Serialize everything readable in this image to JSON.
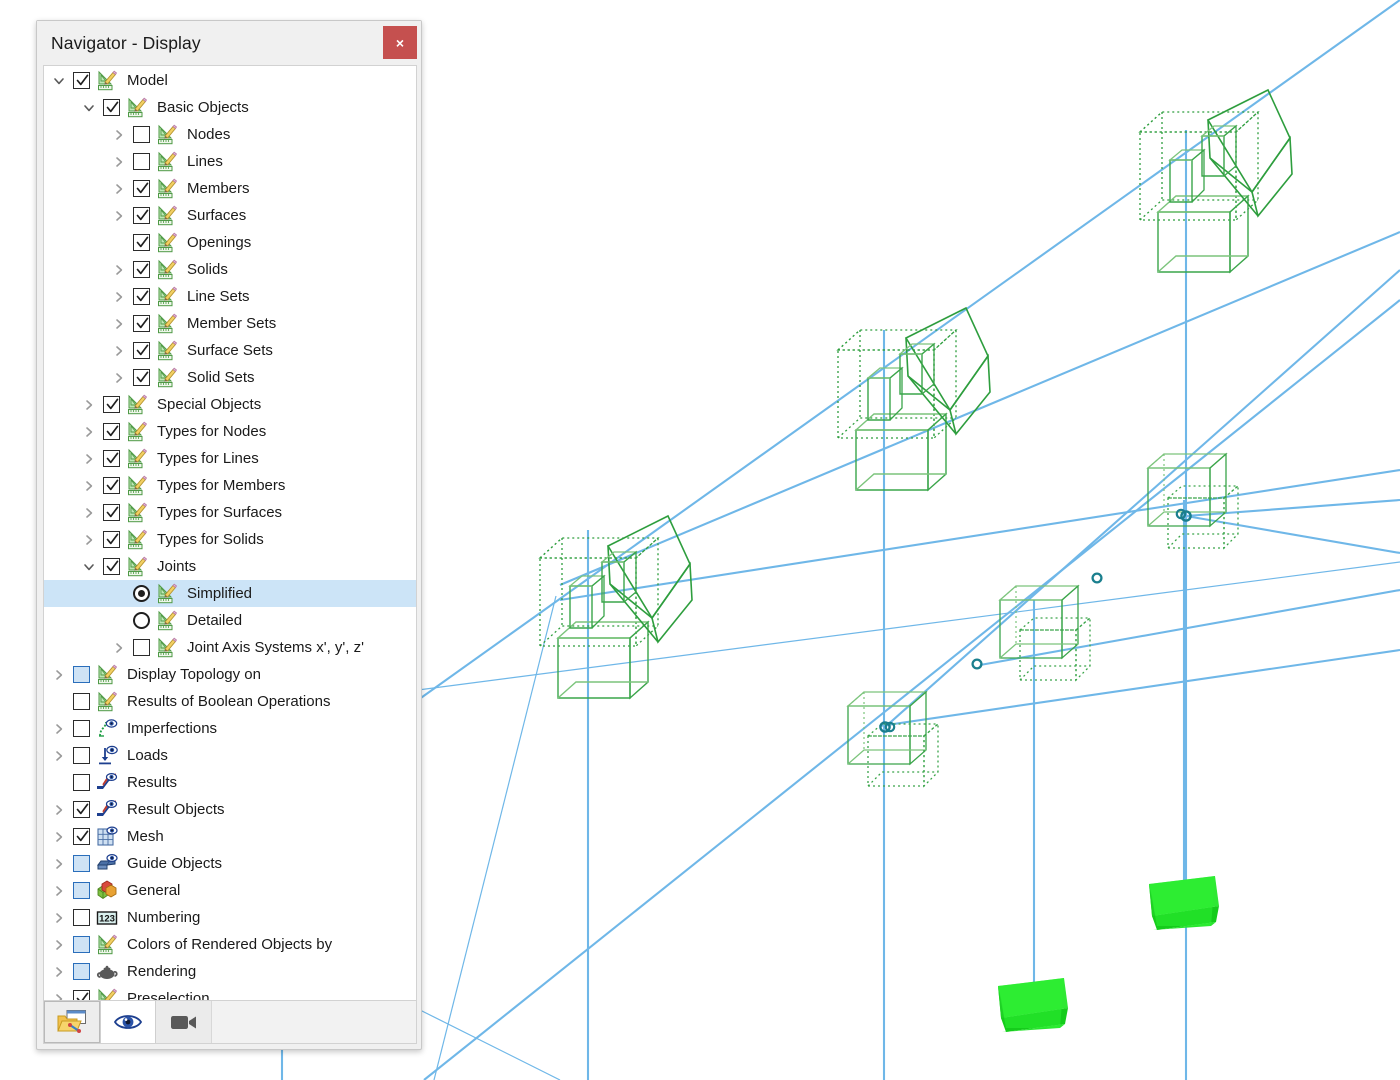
{
  "window": {
    "title": "Navigator - Display",
    "close_label": "×",
    "close_icon": "close-icon"
  },
  "tree": {
    "items": [
      {
        "label": "Model",
        "level": 0,
        "arrow": "down",
        "control": "checkbox",
        "state": "checked",
        "icon": "model-pencil-ruler-icon",
        "selected": false
      },
      {
        "label": "Basic Objects",
        "level": 1,
        "arrow": "down",
        "control": "checkbox",
        "state": "checked",
        "icon": "model-pencil-ruler-icon",
        "selected": false
      },
      {
        "label": "Nodes",
        "level": 2,
        "arrow": "right",
        "control": "checkbox",
        "state": "unchecked",
        "icon": "model-pencil-ruler-icon",
        "selected": false
      },
      {
        "label": "Lines",
        "level": 2,
        "arrow": "right",
        "control": "checkbox",
        "state": "unchecked",
        "icon": "model-pencil-ruler-icon",
        "selected": false
      },
      {
        "label": "Members",
        "level": 2,
        "arrow": "right",
        "control": "checkbox",
        "state": "checked",
        "icon": "model-pencil-ruler-icon",
        "selected": false
      },
      {
        "label": "Surfaces",
        "level": 2,
        "arrow": "right",
        "control": "checkbox",
        "state": "checked",
        "icon": "model-pencil-ruler-icon",
        "selected": false
      },
      {
        "label": "Openings",
        "level": 2,
        "arrow": "none",
        "control": "checkbox",
        "state": "checked",
        "icon": "model-pencil-ruler-icon",
        "selected": false
      },
      {
        "label": "Solids",
        "level": 2,
        "arrow": "right",
        "control": "checkbox",
        "state": "checked",
        "icon": "model-pencil-ruler-icon",
        "selected": false
      },
      {
        "label": "Line Sets",
        "level": 2,
        "arrow": "right",
        "control": "checkbox",
        "state": "checked",
        "icon": "model-pencil-ruler-icon",
        "selected": false
      },
      {
        "label": "Member Sets",
        "level": 2,
        "arrow": "right",
        "control": "checkbox",
        "state": "checked",
        "icon": "model-pencil-ruler-icon",
        "selected": false
      },
      {
        "label": "Surface Sets",
        "level": 2,
        "arrow": "right",
        "control": "checkbox",
        "state": "checked",
        "icon": "model-pencil-ruler-icon",
        "selected": false
      },
      {
        "label": "Solid Sets",
        "level": 2,
        "arrow": "right",
        "control": "checkbox",
        "state": "checked",
        "icon": "model-pencil-ruler-icon",
        "selected": false
      },
      {
        "label": "Special Objects",
        "level": 1,
        "arrow": "right",
        "control": "checkbox",
        "state": "checked",
        "icon": "model-pencil-ruler-icon",
        "selected": false
      },
      {
        "label": "Types for Nodes",
        "level": 1,
        "arrow": "right",
        "control": "checkbox",
        "state": "checked",
        "icon": "model-pencil-ruler-icon",
        "selected": false
      },
      {
        "label": "Types for Lines",
        "level": 1,
        "arrow": "right",
        "control": "checkbox",
        "state": "checked",
        "icon": "model-pencil-ruler-icon",
        "selected": false
      },
      {
        "label": "Types for Members",
        "level": 1,
        "arrow": "right",
        "control": "checkbox",
        "state": "checked",
        "icon": "model-pencil-ruler-icon",
        "selected": false
      },
      {
        "label": "Types for Surfaces",
        "level": 1,
        "arrow": "right",
        "control": "checkbox",
        "state": "checked",
        "icon": "model-pencil-ruler-icon",
        "selected": false
      },
      {
        "label": "Types for Solids",
        "level": 1,
        "arrow": "right",
        "control": "checkbox",
        "state": "checked",
        "icon": "model-pencil-ruler-icon",
        "selected": false
      },
      {
        "label": "Joints",
        "level": 1,
        "arrow": "down",
        "control": "checkbox",
        "state": "checked",
        "icon": "model-pencil-ruler-icon",
        "selected": false
      },
      {
        "label": "Simplified",
        "level": 2,
        "arrow": "none",
        "control": "radio",
        "state": "on",
        "icon": "model-pencil-ruler-icon",
        "selected": true
      },
      {
        "label": "Detailed",
        "level": 2,
        "arrow": "none",
        "control": "radio",
        "state": "off",
        "icon": "model-pencil-ruler-icon",
        "selected": false
      },
      {
        "label": "Joint Axis Systems x', y', z'",
        "level": 2,
        "arrow": "right",
        "control": "checkbox",
        "state": "unchecked",
        "icon": "model-pencil-ruler-icon",
        "selected": false
      },
      {
        "label": "Display Topology on",
        "level": 0,
        "arrow": "right",
        "control": "checkbox",
        "state": "partial",
        "icon": "model-pencil-ruler-icon",
        "selected": false
      },
      {
        "label": "Results of Boolean Operations",
        "level": 0,
        "arrow": "none",
        "control": "checkbox",
        "state": "unchecked",
        "icon": "model-pencil-ruler-icon",
        "selected": false
      },
      {
        "label": "Imperfections",
        "level": 0,
        "arrow": "right",
        "control": "checkbox",
        "state": "unchecked",
        "icon": "imperfections-eye-icon",
        "selected": false
      },
      {
        "label": "Loads",
        "level": 0,
        "arrow": "right",
        "control": "checkbox",
        "state": "unchecked",
        "icon": "load-arrow-eye-icon",
        "selected": false
      },
      {
        "label": "Results",
        "level": 0,
        "arrow": "none",
        "control": "checkbox",
        "state": "unchecked",
        "icon": "results-curve-eye-icon",
        "selected": false
      },
      {
        "label": "Result Objects",
        "level": 0,
        "arrow": "right",
        "control": "checkbox",
        "state": "checked",
        "icon": "results-curve-eye-icon",
        "selected": false
      },
      {
        "label": "Mesh",
        "level": 0,
        "arrow": "right",
        "control": "checkbox",
        "state": "checked",
        "icon": "mesh-grid-eye-icon",
        "selected": false
      },
      {
        "label": "Guide Objects",
        "level": 0,
        "arrow": "right",
        "control": "checkbox",
        "state": "partial",
        "icon": "guide-objects-eye-icon",
        "selected": false
      },
      {
        "label": "General",
        "level": 0,
        "arrow": "right",
        "control": "checkbox",
        "state": "partial",
        "icon": "general-cubes-icon",
        "selected": false
      },
      {
        "label": "Numbering",
        "level": 0,
        "arrow": "right",
        "control": "checkbox",
        "state": "unchecked",
        "icon": "numbering-123-icon",
        "selected": false
      },
      {
        "label": "Colors of Rendered Objects by",
        "level": 0,
        "arrow": "right",
        "control": "checkbox",
        "state": "partial",
        "icon": "model-pencil-ruler-icon",
        "selected": false
      },
      {
        "label": "Rendering",
        "level": 0,
        "arrow": "right",
        "control": "checkbox",
        "state": "partial",
        "icon": "rendering-teapot-icon",
        "selected": false
      },
      {
        "label": "Preselection",
        "level": 0,
        "arrow": "right",
        "control": "checkbox",
        "state": "checked",
        "icon": "model-pencil-ruler-icon",
        "selected": false
      }
    ]
  },
  "tabs": [
    {
      "name": "display-tab",
      "icon": "folder-display-icon",
      "state": "selected"
    },
    {
      "name": "views-tab",
      "icon": "eye-icon",
      "state": "active"
    },
    {
      "name": "animation-tab",
      "icon": "video-camera-icon",
      "state": "normal"
    }
  ],
  "viewport": {
    "name": "model-3d-view",
    "colors": {
      "member_line": "#6fb7e8",
      "joint_wireframe": "#2e9e3e",
      "joint_wireframe_light": "#6cbf6c",
      "node_marker": "#1a7f8e",
      "support_solid": "#22e028",
      "background": "#ffffff"
    }
  }
}
